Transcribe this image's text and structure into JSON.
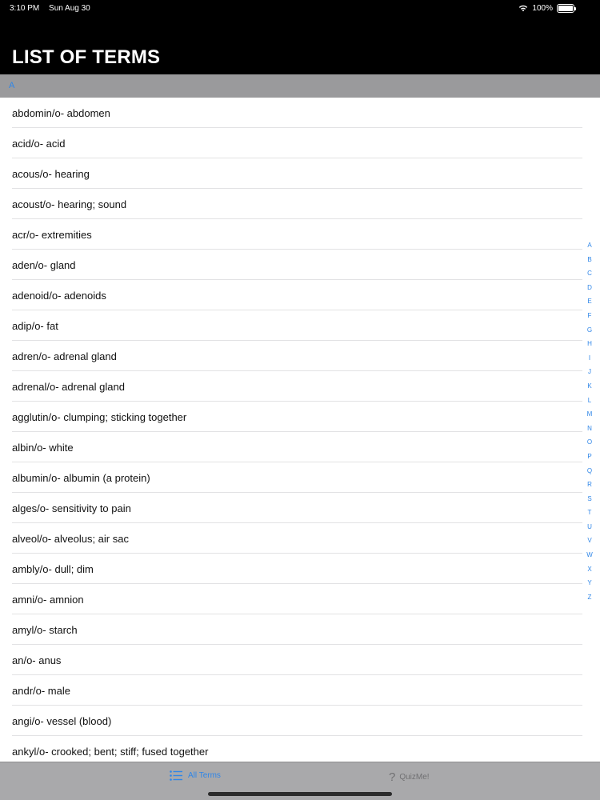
{
  "status": {
    "time": "3:10 PM",
    "date": "Sun Aug 30",
    "battery": "100%"
  },
  "nav": {
    "title": "LIST OF TERMS"
  },
  "section": {
    "header": "A"
  },
  "terms": [
    "abdomin/o- abdomen",
    "acid/o- acid",
    "acous/o- hearing",
    "acoust/o- hearing; sound",
    "acr/o- extremities",
    "aden/o- gland",
    "adenoid/o- adenoids",
    "adip/o- fat",
    "adren/o- adrenal gland",
    "adrenal/o- adrenal gland",
    "agglutin/o- clumping; sticking together",
    "albin/o- white",
    "albumin/o- albumin (a protein)",
    "alges/o- sensitivity to pain",
    "alveol/o- alveolus; air sac",
    "ambly/o- dull; dim",
    "amni/o- amnion",
    "amyl/o- starch",
    "an/o- anus",
    "andr/o- male",
    "angi/o- vessel (blood)",
    "ankyl/o- crooked; bent; stiff; fused together"
  ],
  "index": [
    "A",
    "B",
    "C",
    "D",
    "E",
    "F",
    "G",
    "H",
    "I",
    "J",
    "K",
    "L",
    "M",
    "N",
    "O",
    "P",
    "Q",
    "R",
    "S",
    "T",
    "U",
    "V",
    "W",
    "X",
    "Y",
    "Z"
  ],
  "tabs": {
    "all_terms": "All Terms",
    "quiz": "QuizMe!"
  },
  "colors": {
    "accent": "#2f86e8",
    "nav_bg": "#000000",
    "section_bg": "#9a9a9c",
    "tabbar_bg": "#a9a9ab"
  }
}
